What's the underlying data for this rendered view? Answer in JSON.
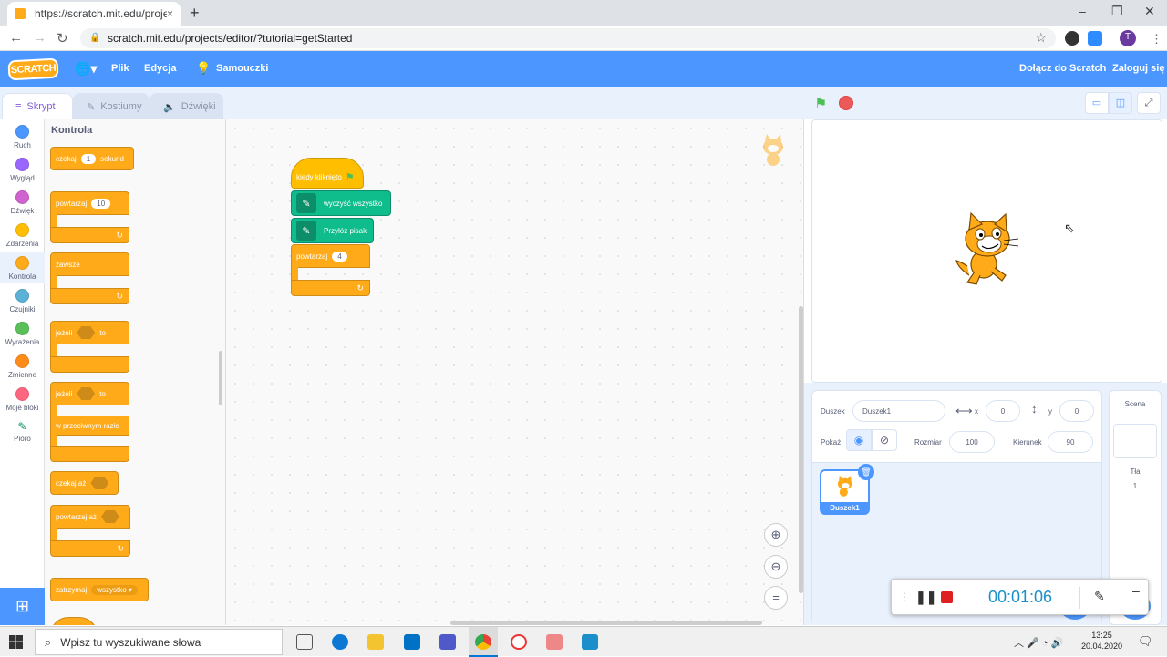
{
  "browser": {
    "tab_title": "https://scratch.mit.edu/projects/e",
    "tab_close": "×",
    "new_tab": "+",
    "url": "scratch.mit.edu/projects/editor/?tutorial=getStarted",
    "profile_initial": "T",
    "window_buttons": [
      "–",
      "❐",
      "✕"
    ]
  },
  "menubar": {
    "logo": "SCRATCH",
    "file": "Plik",
    "edit": "Edycja",
    "tutorials": "Samouczki",
    "join": "Dołącz do Scratch",
    "signin": "Zaloguj się"
  },
  "editor_tabs": [
    "Skrypt",
    "Kostiumy",
    "Dźwięki"
  ],
  "categories": [
    {
      "label": "Ruch",
      "color": "#4c97ff"
    },
    {
      "label": "Wygląd",
      "color": "#9966ff"
    },
    {
      "label": "Dźwięk",
      "color": "#cf63cf"
    },
    {
      "label": "Zdarzenia",
      "color": "#ffbf00"
    },
    {
      "label": "Kontrola",
      "color": "#ffab19"
    },
    {
      "label": "Czujniki",
      "color": "#5cb1d6"
    },
    {
      "label": "Wyrażenia",
      "color": "#59c059"
    },
    {
      "label": "Zmienne",
      "color": "#ff8c1a"
    },
    {
      "label": "Moje bloki",
      "color": "#ff6680"
    },
    {
      "label": "Pióro",
      "color": "#0fbd8c"
    }
  ],
  "palette": {
    "title": "Kontrola",
    "wait": "czekaj",
    "wait_value": "1",
    "wait_unit": "sekund",
    "repeat": "powtarzaj",
    "repeat_value": "10",
    "forever": "zawsze",
    "if": "jeżeli",
    "then": "to",
    "if2": "jeżeli",
    "then2": "to",
    "else": "w przeciwnym razie",
    "wait_until": "czekaj aż",
    "repeat_until": "powtarzaj aż",
    "stop": "zatrzymaj",
    "stop_value": "wszystko ▾"
  },
  "script": {
    "hat": "kiedy kliknięto",
    "clear": "wyczyść wszystko",
    "pen_down": "Przyłóż pisak",
    "repeat": "powtarzaj",
    "repeat_value": "4"
  },
  "sprite_info": {
    "sprite_label": "Duszek",
    "sprite_name": "Duszek1",
    "x_label": "x",
    "x_value": "0",
    "y_label": "y",
    "y_value": "0",
    "show_label": "Pokaż",
    "size_label": "Rozmiar",
    "size_value": "100",
    "direction_label": "Kierunek",
    "direction_value": "90",
    "tile_name": "Duszek1"
  },
  "scene": {
    "title": "Scena",
    "backdrops_label": "Tła",
    "backdrops_count": "1"
  },
  "recorder": {
    "time": "00:01:06",
    "minimize": "–"
  },
  "taskbar": {
    "search_placeholder": "Wpisz tu wyszukiwane słowa",
    "time": "13:25",
    "date": "20.04.2020"
  }
}
